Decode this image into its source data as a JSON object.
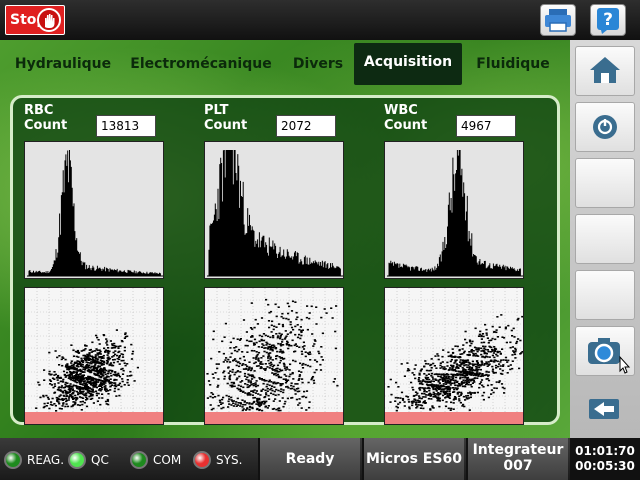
{
  "topbar": {
    "stop_label": "Stop",
    "stop_icon": "stop-hand-icon",
    "print_icon": "printer-icon",
    "help_label": "?",
    "help_icon": "help-icon"
  },
  "tabs": [
    {
      "label": "Hydraulique",
      "active": false
    },
    {
      "label": "Electromécanique",
      "active": false
    },
    {
      "label": "Divers",
      "active": false
    },
    {
      "label": "Acquisition",
      "active": true
    },
    {
      "label": "Fluidique",
      "active": false
    }
  ],
  "acquisition": {
    "rbc": {
      "label": "RBC\nCount",
      "count": "13813"
    },
    "plt": {
      "label": "PLT\nCount",
      "count": "2072"
    },
    "wbc": {
      "label": "WBC\nCount",
      "count": "4967"
    }
  },
  "sidebar": {
    "buttons": [
      {
        "icon": "home-icon"
      },
      {
        "icon": "power-icon"
      },
      {
        "icon": ""
      },
      {
        "icon": ""
      },
      {
        "icon": ""
      },
      {
        "icon": "camera-icon"
      },
      {
        "icon": "back-arrow-icon"
      }
    ]
  },
  "statusbar": {
    "indicators": [
      {
        "label": "REAG.",
        "color": "#1e8a1e"
      },
      {
        "label": "QC",
        "color": "#4fe34f"
      },
      {
        "label": "COM",
        "color": "#1e8a1e"
      },
      {
        "label": "SYS.",
        "color": "#e83030"
      }
    ],
    "status": "Ready",
    "instrument": "Micros ES60",
    "user_line1": "Integrateur",
    "user_line2": "007",
    "time": "01:01:70",
    "elapsed": "00:05:30"
  },
  "chart_data": [
    {
      "type": "bar",
      "title": "RBC histogram",
      "categories": [],
      "values": []
    },
    {
      "type": "scatter",
      "title": "RBC scattergram",
      "x": [],
      "y": []
    },
    {
      "type": "bar",
      "title": "PLT histogram",
      "categories": [],
      "values": []
    },
    {
      "type": "scatter",
      "title": "PLT scattergram",
      "x": [],
      "y": []
    },
    {
      "type": "bar",
      "title": "WBC histogram",
      "categories": [],
      "values": []
    },
    {
      "type": "scatter",
      "title": "WBC scattergram",
      "x": [],
      "y": []
    }
  ]
}
